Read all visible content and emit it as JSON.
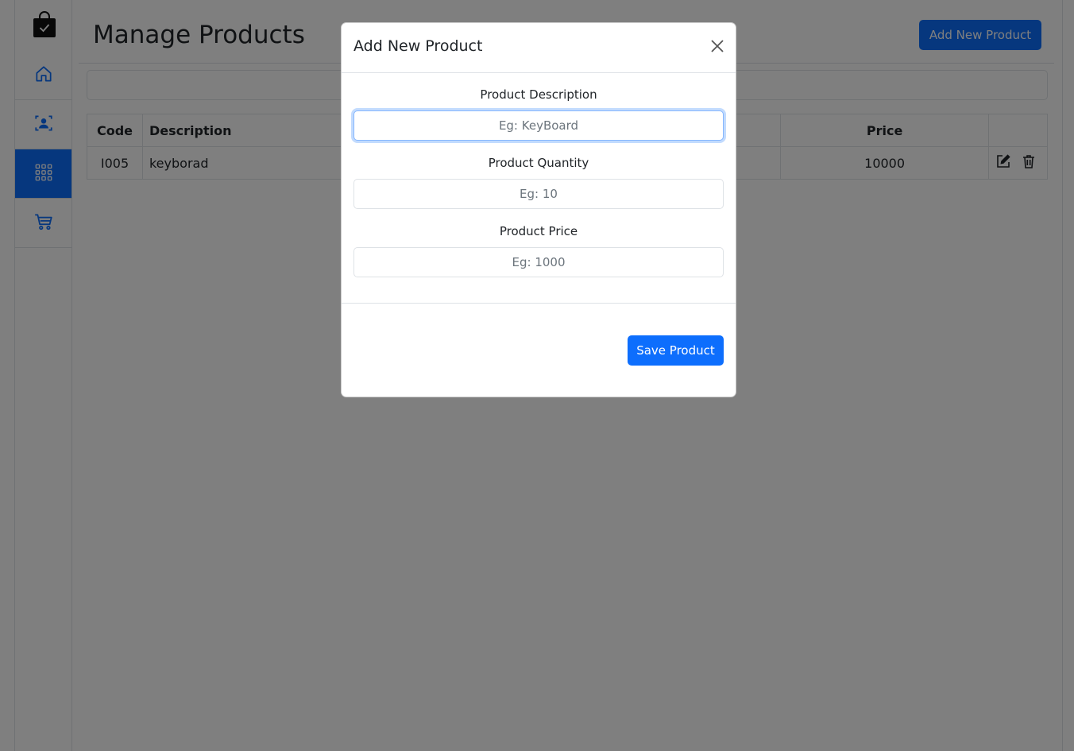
{
  "colors": {
    "primary": "#0d6efd",
    "border": "#dee2e6",
    "backdrop": "rgba(0,0,0,0.5)"
  },
  "sidebar": {
    "logo_icon": "shopping-bag-check-icon",
    "items": [
      {
        "icon": "home-icon",
        "active": false
      },
      {
        "icon": "customer-badge-icon",
        "active": false
      },
      {
        "icon": "grid-apps-icon",
        "active": true
      },
      {
        "icon": "cart-icon",
        "active": false
      }
    ]
  },
  "header": {
    "title": "Manage Products",
    "add_button_label": "Add New Product"
  },
  "table": {
    "columns": {
      "code": "Code",
      "description": "Description",
      "price": "Price"
    },
    "rows": [
      {
        "code": "I005",
        "description": "keyborad",
        "price": "10000",
        "actions": [
          "edit-icon",
          "trash-icon"
        ]
      }
    ]
  },
  "modal": {
    "title": "Add New Product",
    "close_icon": "close-icon",
    "fields": [
      {
        "label": "Product Description",
        "placeholder": "Eg: KeyBoard",
        "value": ""
      },
      {
        "label": "Product Quantity",
        "placeholder": "Eg: 10",
        "value": ""
      },
      {
        "label": "Product Price",
        "placeholder": "Eg: 1000",
        "value": ""
      }
    ],
    "save_label": "Save Product"
  }
}
